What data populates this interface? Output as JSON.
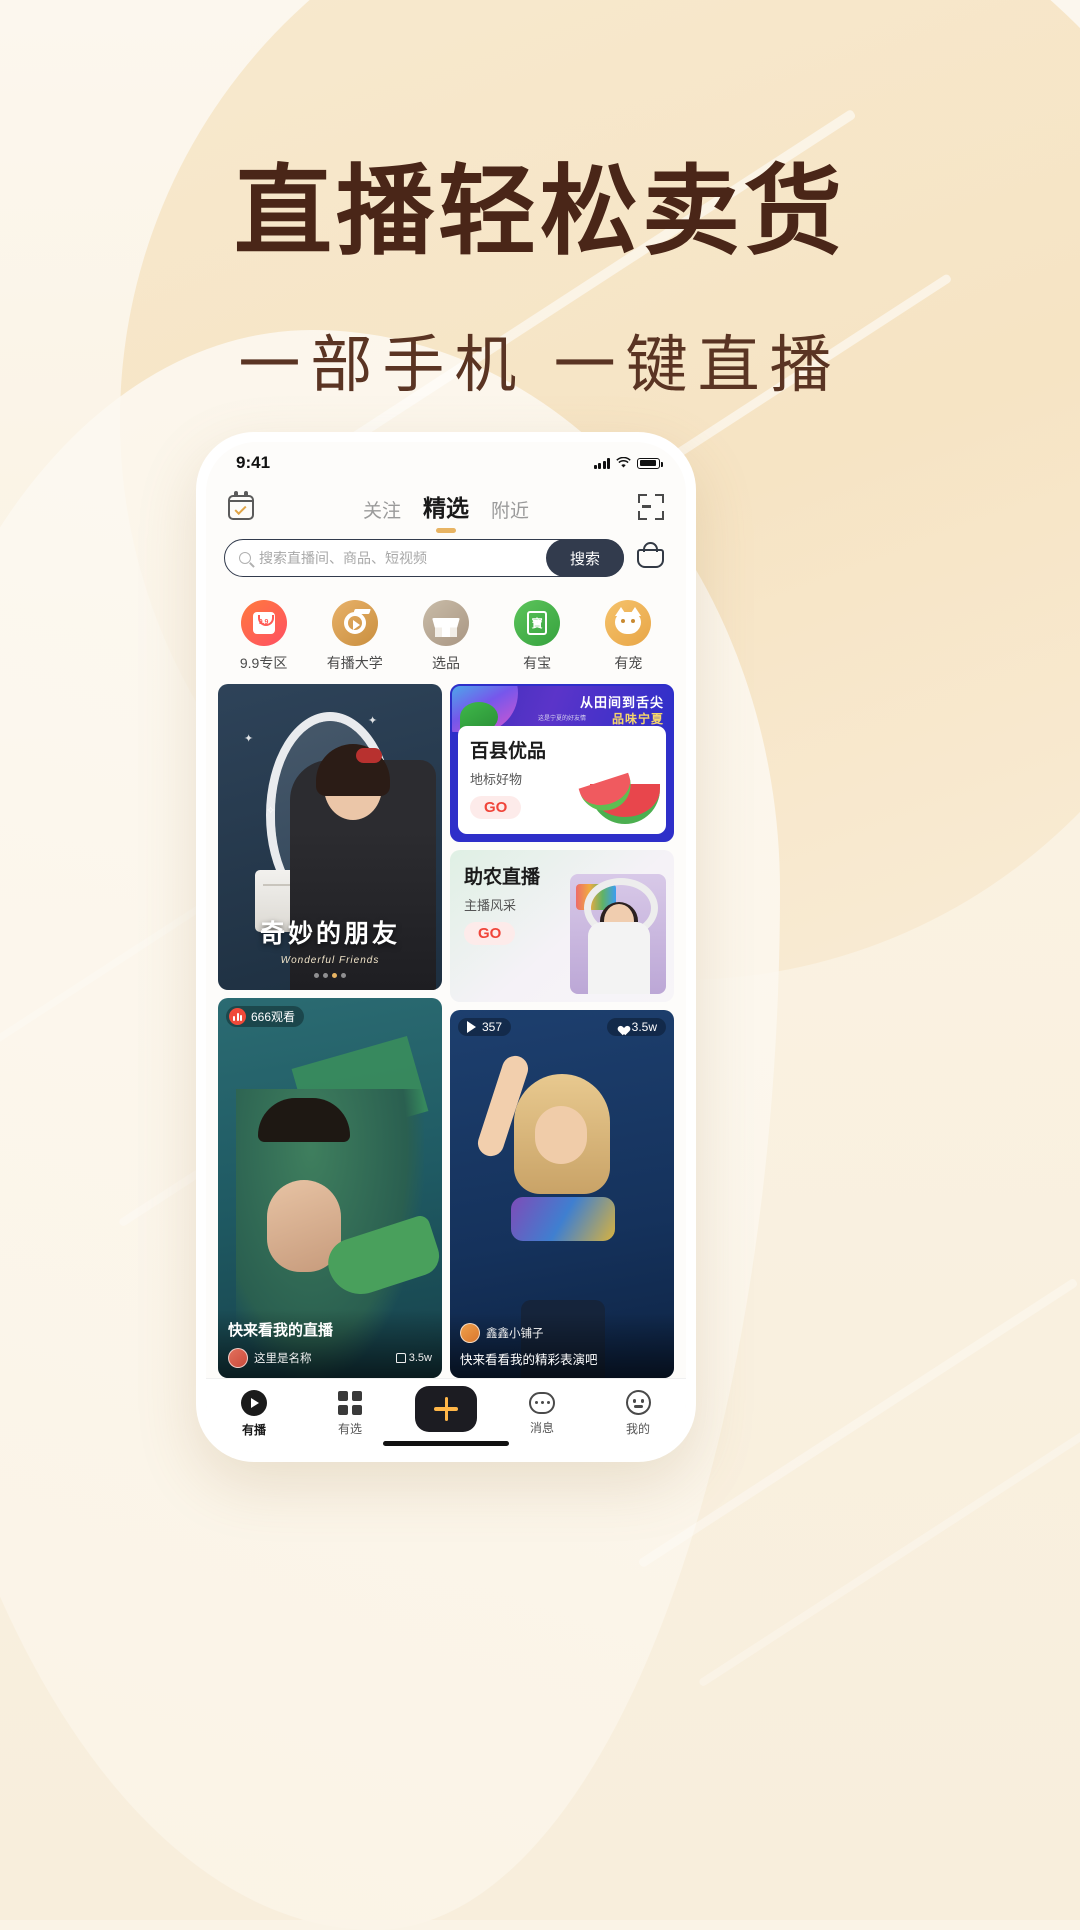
{
  "hero": {
    "title": "直播轻松卖货",
    "subtitle": "一部手机 一键直播",
    "title_color": "#4A2618",
    "bg_color": "#F7E9CE"
  },
  "phone": {
    "status": {
      "time": "9:41"
    },
    "topbar": {
      "calendar_icon": "calendar-check-icon",
      "scan_icon": "scan-icon",
      "tabs": [
        {
          "label": "关注",
          "active": false
        },
        {
          "label": "精选",
          "active": true
        },
        {
          "label": "附近",
          "active": false
        }
      ]
    },
    "search": {
      "placeholder": "搜索直播间、商品、短视频",
      "button_label": "搜索",
      "search_icon": "search-icon",
      "cart_icon": "cart-icon"
    },
    "categories": [
      {
        "label": "9.9专区",
        "icon": "bag-99-icon",
        "color": "#FF5B56"
      },
      {
        "label": "有播大学",
        "icon": "graduation-play-icon",
        "color": "#D79B45"
      },
      {
        "label": "选品",
        "icon": "shop-icon",
        "color": "#B2A08C"
      },
      {
        "label": "有宝",
        "icon": "treasure-icon",
        "color": "#41A74A"
      },
      {
        "label": "有宠",
        "icon": "pet-icon",
        "color": "#EDB157"
      }
    ],
    "feed": {
      "mirror_card": {
        "title": "奇妙的朋友",
        "subtitle": "Wonderful Friends",
        "dots": 4,
        "active_dot": 2
      },
      "promo_baixian": {
        "banner_main": "从田间到舌尖",
        "banner_accent": "品味宁夏",
        "banner_small": "这是宁夏的好友情",
        "title": "百县优品",
        "subtitle": "地标好物",
        "cta": "GO"
      },
      "promo_zhunong": {
        "title": "助农直播",
        "subtitle": "主播风采",
        "cta": "GO"
      },
      "live_left": {
        "viewers": "666观看",
        "viewers_icon": "live-bars-icon",
        "title": "快来看我的直播",
        "author": "这里是名称",
        "likes": "3.5w",
        "like_icon": "thumbs-up-icon"
      },
      "live_right": {
        "plays": "357",
        "play_icon": "play-icon",
        "likes": "3.5w",
        "like_icon": "heart-icon",
        "author": "鑫鑫小铺子",
        "title": "快来看看我的精彩表演吧"
      }
    },
    "bottomnav": [
      {
        "label": "有播",
        "icon": "play-circle-icon",
        "active": true
      },
      {
        "label": "有选",
        "icon": "grid-icon",
        "active": false
      },
      {
        "label": "",
        "icon": "plus-icon",
        "active": false
      },
      {
        "label": "消息",
        "icon": "message-icon",
        "active": false
      },
      {
        "label": "我的",
        "icon": "profile-icon",
        "active": false
      }
    ]
  }
}
